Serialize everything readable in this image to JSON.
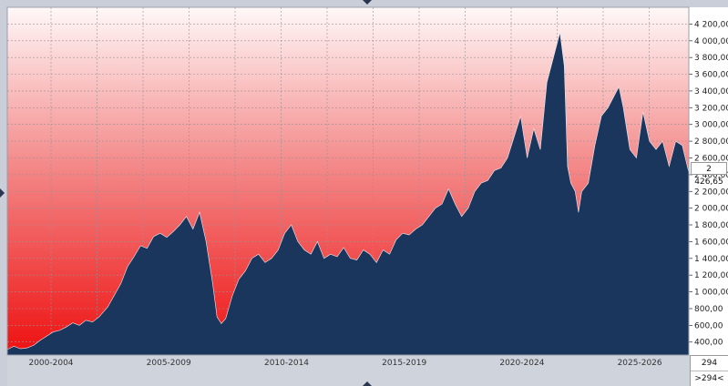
{
  "chart_data": {
    "type": "area",
    "title": "",
    "xlabel": "",
    "ylabel": "",
    "x_tick_labels": [
      "2000-2004",
      "2005-2009",
      "2010-2014",
      "2015-2019",
      "2020-2024",
      "2025-2026"
    ],
    "x_range": [
      2000.0,
      2026.2
    ],
    "y_tick_labels": [
      "400,00",
      "600,00",
      "800,00",
      "1 000,00",
      "1 200,00",
      "1 400,00",
      "1 600,00",
      "1 800,00",
      "2 000,00",
      "2 200,00",
      "2 400,00",
      "2 600,00",
      "2 800,00",
      "3 000,00",
      "3 200,00",
      "3 400,00",
      "3 600,00",
      "3 800,00",
      "4 000,00",
      "4 200,00"
    ],
    "y_tick_values": [
      400,
      600,
      800,
      1000,
      1200,
      1400,
      1600,
      1800,
      2000,
      2200,
      2400,
      2600,
      2800,
      3000,
      3200,
      3400,
      3600,
      3800,
      4000,
      4200
    ],
    "ylim": [
      245,
      4400
    ],
    "grid": true,
    "last_value_label": "2 426,65",
    "series": [
      {
        "values": [
          [
            1998.0,
            310
          ],
          [
            1998.3,
            350
          ],
          [
            1998.6,
            320
          ],
          [
            1998.9,
            330
          ],
          [
            1999.2,
            360
          ],
          [
            1999.5,
            420
          ],
          [
            1999.8,
            470
          ],
          [
            2000.1,
            520
          ],
          [
            2000.4,
            540
          ],
          [
            2000.7,
            580
          ],
          [
            2001.0,
            630
          ],
          [
            2001.3,
            600
          ],
          [
            2001.6,
            660
          ],
          [
            2001.9,
            640
          ],
          [
            2002.2,
            700
          ],
          [
            2002.6,
            820
          ],
          [
            2002.9,
            960
          ],
          [
            2003.2,
            1100
          ],
          [
            2003.5,
            1300
          ],
          [
            2003.8,
            1420
          ],
          [
            2004.1,
            1550
          ],
          [
            2004.4,
            1520
          ],
          [
            2004.7,
            1660
          ],
          [
            2005.0,
            1700
          ],
          [
            2005.3,
            1650
          ],
          [
            2005.6,
            1720
          ],
          [
            2005.9,
            1800
          ],
          [
            2006.2,
            1900
          ],
          [
            2006.5,
            1750
          ],
          [
            2006.8,
            1950
          ],
          [
            2007.1,
            1600
          ],
          [
            2007.4,
            1100
          ],
          [
            2007.6,
            700
          ],
          [
            2007.8,
            620
          ],
          [
            2008.0,
            680
          ],
          [
            2008.3,
            950
          ],
          [
            2008.6,
            1150
          ],
          [
            2008.9,
            1250
          ],
          [
            2009.2,
            1400
          ],
          [
            2009.5,
            1450
          ],
          [
            2009.8,
            1350
          ],
          [
            2010.1,
            1400
          ],
          [
            2010.4,
            1500
          ],
          [
            2010.7,
            1700
          ],
          [
            2011.0,
            1800
          ],
          [
            2011.3,
            1600
          ],
          [
            2011.6,
            1500
          ],
          [
            2011.9,
            1450
          ],
          [
            2012.2,
            1600
          ],
          [
            2012.5,
            1400
          ],
          [
            2012.8,
            1450
          ],
          [
            2013.1,
            1420
          ],
          [
            2013.4,
            1530
          ],
          [
            2013.7,
            1400
          ],
          [
            2014.0,
            1380
          ],
          [
            2014.3,
            1500
          ],
          [
            2014.6,
            1450
          ],
          [
            2014.9,
            1350
          ],
          [
            2015.2,
            1500
          ],
          [
            2015.5,
            1450
          ],
          [
            2015.8,
            1620
          ],
          [
            2016.1,
            1700
          ],
          [
            2016.4,
            1680
          ],
          [
            2016.7,
            1750
          ],
          [
            2017.0,
            1800
          ],
          [
            2017.3,
            1900
          ],
          [
            2017.6,
            2000
          ],
          [
            2017.9,
            2050
          ],
          [
            2018.2,
            2230
          ],
          [
            2018.5,
            2050
          ],
          [
            2018.8,
            1900
          ],
          [
            2019.1,
            2000
          ],
          [
            2019.4,
            2200
          ],
          [
            2019.7,
            2300
          ],
          [
            2020.0,
            2330
          ],
          [
            2020.3,
            2450
          ],
          [
            2020.6,
            2480
          ],
          [
            2020.9,
            2600
          ],
          [
            2021.2,
            2850
          ],
          [
            2021.5,
            3100
          ],
          [
            2021.8,
            2600
          ],
          [
            2022.1,
            2950
          ],
          [
            2022.4,
            2700
          ],
          [
            2022.7,
            3500
          ],
          [
            2023.0,
            3800
          ],
          [
            2023.3,
            4100
          ],
          [
            2023.5,
            3700
          ],
          [
            2023.65,
            2500
          ],
          [
            2023.8,
            2300
          ],
          [
            2024.0,
            2200
          ],
          [
            2024.15,
            1950
          ],
          [
            2024.3,
            2200
          ],
          [
            2024.6,
            2300
          ],
          [
            2024.9,
            2750
          ],
          [
            2025.2,
            3100
          ],
          [
            2025.5,
            3200
          ],
          [
            2025.8,
            3350
          ],
          [
            2026.0,
            3450
          ],
          [
            2026.2,
            3200
          ],
          [
            2026.5,
            2700
          ],
          [
            2026.8,
            2600
          ],
          [
            2027.1,
            3150
          ],
          [
            2027.4,
            2800
          ],
          [
            2027.7,
            2700
          ],
          [
            2028.0,
            2800
          ],
          [
            2028.3,
            2500
          ],
          [
            2028.6,
            2800
          ],
          [
            2028.9,
            2750
          ],
          [
            2029.2,
            2426.65
          ]
        ]
      }
    ]
  }
}
